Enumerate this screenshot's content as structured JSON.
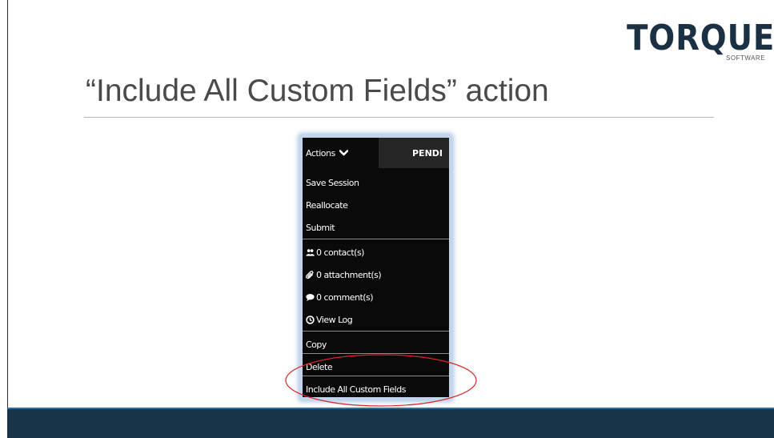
{
  "logo": {
    "word": "TORQUE",
    "sub": "SOFTWARE"
  },
  "slide": {
    "title": "“Include All Custom Fields” action"
  },
  "menu": {
    "actions_label": "Actions",
    "tab_label": "PENDI",
    "items": [
      {
        "label": "Save Session"
      },
      {
        "label": "Reallocate"
      },
      {
        "label": "Submit"
      },
      {
        "label": "0 contact(s)",
        "icon": "contacts-icon"
      },
      {
        "label": "0 attachment(s)",
        "icon": "paperclip-icon"
      },
      {
        "label": "0 comment(s)",
        "icon": "comment-icon"
      },
      {
        "label": "View Log",
        "icon": "clock-icon"
      },
      {
        "label": "Copy"
      },
      {
        "label": "Delete"
      },
      {
        "label": "Include All Custom Fields"
      }
    ]
  },
  "colors": {
    "brand_navy": "#1b3042",
    "footer_band": "#173449",
    "annotation_red": "#d9252a"
  }
}
